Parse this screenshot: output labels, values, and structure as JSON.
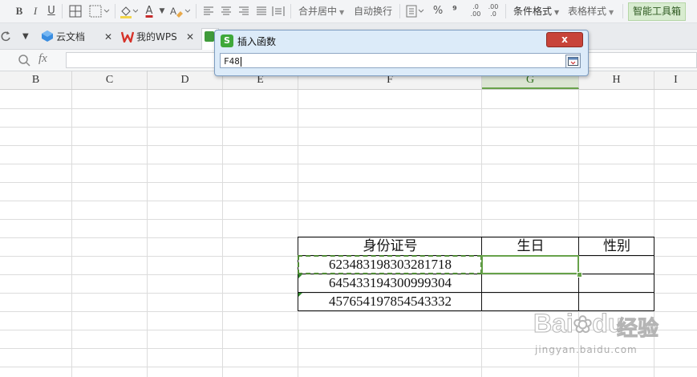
{
  "toolbar": {
    "bold": "B",
    "italic": "I",
    "underline": "U",
    "font_color": "A",
    "merge_center": "合并居中",
    "wrap_text": "自动换行",
    "percent": "%",
    "comma": "⁹",
    "inc_decimal": ".0\n.00",
    "dec_decimal": ".00\n.0",
    "conditional_format": "条件格式",
    "table_style": "表格样式",
    "smart_toolbox": "智能工具箱"
  },
  "tabs": [
    {
      "label": "云文档"
    },
    {
      "label": "我的WPS"
    }
  ],
  "formula_bar": {
    "fx_label": "fx",
    "value": ""
  },
  "dialog": {
    "title": "插入函数",
    "input_value": "F48",
    "close": "x"
  },
  "columns": [
    "B",
    "C",
    "D",
    "E",
    "F",
    "G",
    "H",
    "I"
  ],
  "selected_column": "G",
  "table": {
    "headers": [
      "身份证号",
      "生日",
      "性别"
    ],
    "rows": [
      [
        "623483198303281718",
        "",
        ""
      ],
      [
        "645433194300999304",
        "",
        ""
      ],
      [
        "457654197854543332",
        "",
        ""
      ]
    ]
  },
  "watermark": {
    "brand": "Bai",
    "brand2": "du",
    "product": "经验",
    "url": "jingyan.baidu.com"
  },
  "colors": {
    "accent_green": "#67a24a",
    "copy_dash": "#4f8a35",
    "dialog_bg": "#dcebf9",
    "close_red": "#c8443a",
    "smart_toolbox_bg": "#d8ecd0"
  }
}
